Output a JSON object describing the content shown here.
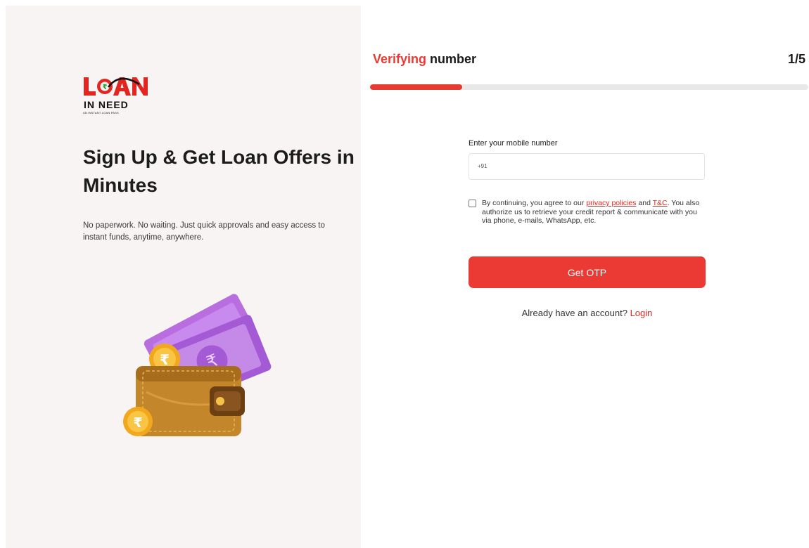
{
  "brand": {
    "logo_line1": "LOAN",
    "logo_line2": "IN NEED",
    "logo_tagline": "AN INSTANT LOAN PASS",
    "primary_color": "#ea3a33"
  },
  "hero": {
    "headline": "Sign Up & Get Loan Offers in Minutes",
    "subtext": "No paperwork. No waiting. Just quick approvals and easy access to instant funds, anytime, anywhere.",
    "currency_symbol": "₹",
    "illustration_icon": "wallet-with-cash-icon"
  },
  "step": {
    "title_accent": "Verifying",
    "title_rest": " number",
    "count": "1/5",
    "progress": 0.21
  },
  "form": {
    "mobile_label": "Enter your mobile number",
    "mobile_prefix": "+91",
    "mobile_value": "",
    "consent_pre": "By continuing, you agree to our ",
    "privacy_link": "privacy policies",
    "consent_and": " and ",
    "tc_link": "T&C",
    "consent_post": ". You also authorize us to retrieve your credit report & communicate with you via phone, e-mails, WhatsApp, etc.",
    "consent_checked": false,
    "otp_button": "Get OTP",
    "account_prompt": "Already have an account? ",
    "login_link": "Login"
  }
}
